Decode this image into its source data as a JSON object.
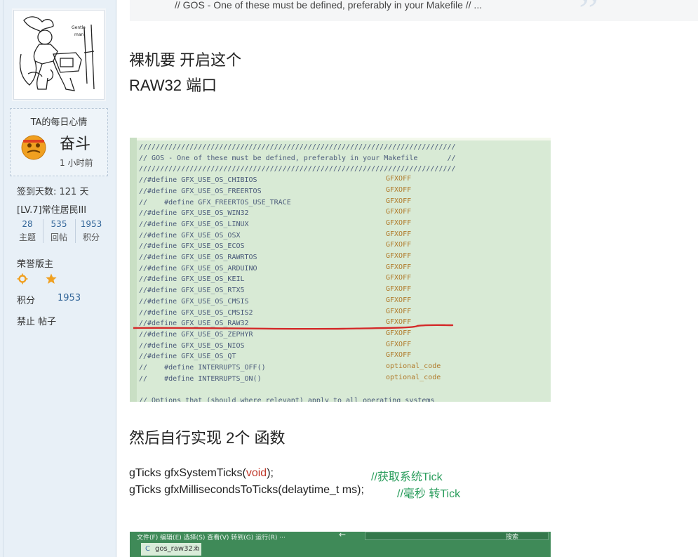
{
  "sidebar": {
    "mood_title": "TA的每日心情",
    "mood_text": "奋斗",
    "mood_time": "1 小时前",
    "checkin": "签到天数: 121 天",
    "level": "[LV.7]常住居民III",
    "stats": [
      {
        "value": "28",
        "label": "主题"
      },
      {
        "value": "535",
        "label": "回帖"
      },
      {
        "value": "1953",
        "label": "积分"
      }
    ],
    "honor": "荣誉版主",
    "score_label": "积分",
    "score_value": "1953",
    "ban": "禁止 帖子",
    "avatar_text_1": "Gentle",
    "avatar_text_2": "man"
  },
  "post": {
    "quote": "// GOS - One of these must be defined, preferably in your Makefile       // ...",
    "heading_1": "裸机要 开启这个",
    "heading_2": "RAW32 端口",
    "code_lines": [
      {
        "text": "///////////////////////////////////////////////////////////////////////////",
        "val": ""
      },
      {
        "text": "// GOS - One of these must be defined, preferably in your Makefile       //",
        "val": ""
      },
      {
        "text": "///////////////////////////////////////////////////////////////////////////",
        "val": ""
      },
      {
        "text": "//#define GFX_USE_OS_CHIBIOS",
        "val": "GFXOFF"
      },
      {
        "text": "//#define GFX_USE_OS_FREERTOS",
        "val": "GFXOFF"
      },
      {
        "text": "//    #define GFX_FREERTOS_USE_TRACE",
        "val": "GFXOFF"
      },
      {
        "text": "//#define GFX_USE_OS_WIN32",
        "val": "GFXOFF"
      },
      {
        "text": "//#define GFX_USE_OS_LINUX",
        "val": "GFXOFF"
      },
      {
        "text": "//#define GFX_USE_OS_OSX",
        "val": "GFXOFF"
      },
      {
        "text": "//#define GFX_USE_OS_ECOS",
        "val": "GFXOFF"
      },
      {
        "text": "//#define GFX_USE_OS_RAWRTOS",
        "val": "GFXOFF"
      },
      {
        "text": "//#define GFX_USE_OS_ARDUINO",
        "val": "GFXOFF"
      },
      {
        "text": "//#define GFX_USE_OS_KEIL",
        "val": "GFXOFF"
      },
      {
        "text": "//#define GFX_USE_OS_RTX5",
        "val": "GFXOFF"
      },
      {
        "text": "//#define GFX_USE_OS_CMSIS",
        "val": "GFXOFF"
      },
      {
        "text": "//#define GFX_USE_OS_CMSIS2",
        "val": "GFXOFF"
      },
      {
        "text": "//#define GFX_USE_OS_RAW32",
        "val": "GFXOFF"
      },
      {
        "text": "//#define GFX_USE_OS_ZEPHYR",
        "val": "GFXOFF"
      },
      {
        "text": "//#define GFX_USE_OS_NIOS",
        "val": "GFXOFF"
      },
      {
        "text": "//#define GFX_USE_OS_QT",
        "val": "GFXOFF"
      },
      {
        "text": "//    #define INTERRUPTS_OFF()",
        "val": "optional_code"
      },
      {
        "text": "//    #define INTERRUPTS_ON()",
        "val": "optional_code"
      },
      {
        "text": "",
        "val": ""
      },
      {
        "text": "// Options that (should where relevant) apply to all operating systems",
        "val": ""
      }
    ],
    "heading_3": "然后自行实现 2个 函数",
    "fn1_prefix": "gTicks gfxSystemTicks(",
    "fn1_kw": "void",
    "fn1_suffix": ");",
    "fn1_comment": "//获取系统Tick",
    "fn2_text": "gTicks gfxMillisecondsToTicks(delaytime_t ms);",
    "fn2_comment": "//毫秒 转Tick",
    "ide_menu": "文件(F)    编辑(E)    选择(S)    查看(V)    转到(G)    运行(R)    ···",
    "ide_search": "搜索",
    "ide_tab": "gos_raw32.h"
  },
  "colors": {
    "code_bg": "#d8ead5",
    "red_mark": "#d42a2a",
    "comment_green": "#2a9d5c",
    "link_blue": "#336699"
  }
}
